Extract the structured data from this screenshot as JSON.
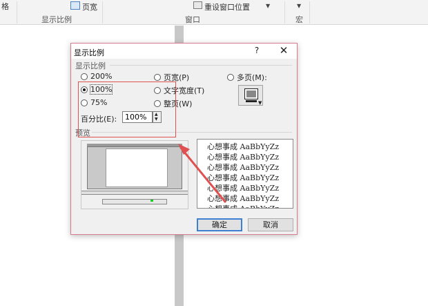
{
  "ribbon": {
    "left_fragment": "格",
    "page_width_label": "页宽",
    "group_zoom_label": "显示比例",
    "reset_window_label": "重设窗口位置",
    "group_window_label": "窗口",
    "group_macro_label": "宏"
  },
  "dialog": {
    "title": "显示比例",
    "help": "?",
    "close": "✕",
    "zoom_group_label": "显示比例",
    "options": {
      "p200": "200%",
      "p100": "100%",
      "p75": "75%",
      "page_width": "页宽(P)",
      "text_width": "文字宽度(T)",
      "whole_page": "整页(W)",
      "multi_page": "多页(M):"
    },
    "selected": "100%",
    "percent_label": "百分比(E):",
    "percent_value": "100%",
    "preview_label": "预览",
    "sample_lines": [
      "心想事成 AaBbYyZz",
      "心想事成 AaBbYyZz",
      "心想事成 AaBbYyZz",
      "心想事成 AaBbYyZz",
      "心想事成 AaBbYyZz",
      "心想事成 AaBbYyZz",
      "心想事成 AaBbYyZz"
    ],
    "ok_label": "确定",
    "cancel_label": "取消"
  },
  "colors": {
    "dialog_border": "#d77a8e",
    "annotation": "#e05050",
    "default_button": "#3c7fd3"
  }
}
